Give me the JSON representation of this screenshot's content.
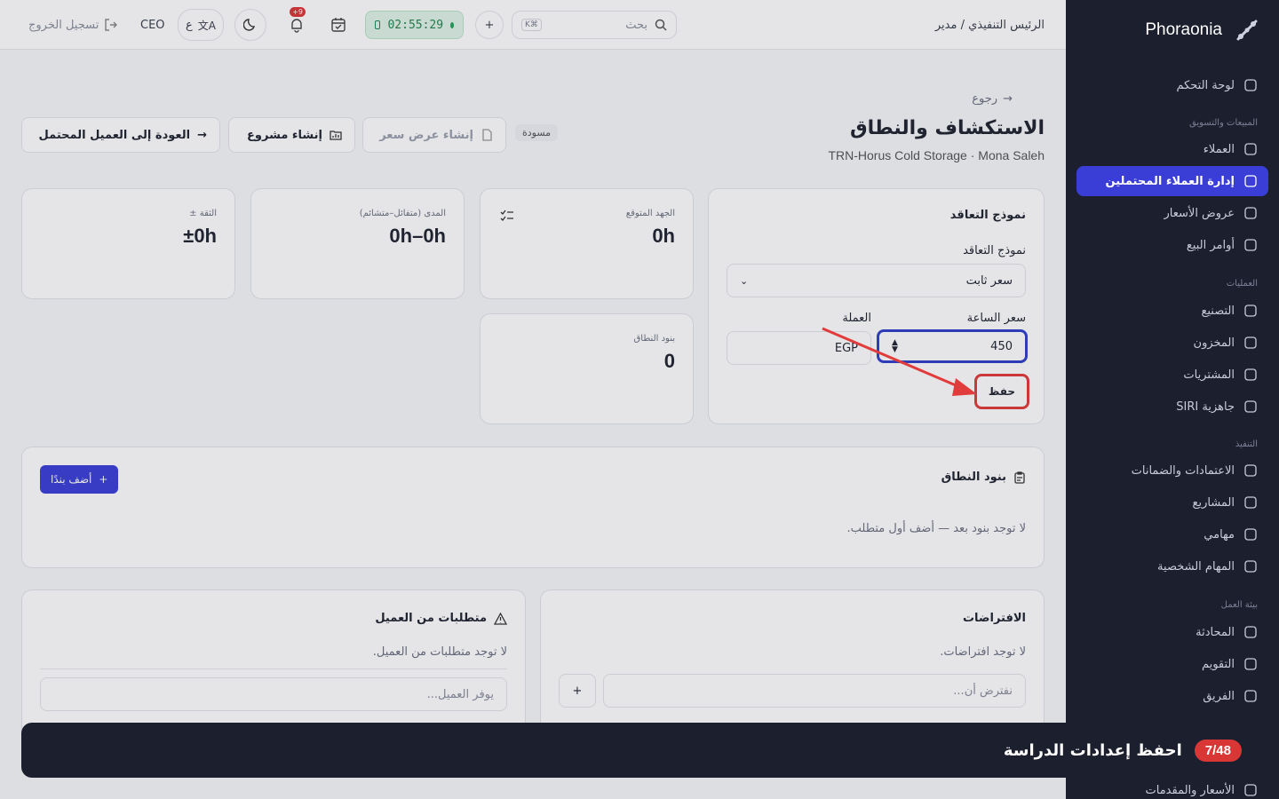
{
  "app": {
    "brand": "Phoraonia"
  },
  "topbar": {
    "breadcrumb": "الرئيس التنفيذي / مدير",
    "search_placeholder": "بحث",
    "search_shortcut": "K⌘",
    "timer": "02:55:29",
    "notifications_badge": "+9",
    "role": "CEO",
    "lang": "ع",
    "logout": "تسجيل الخروج"
  },
  "sidebar": {
    "items": [
      {
        "label": "لوحة التحكم",
        "icon": "grid-icon"
      },
      {
        "section": "المبيعات والتسويق"
      },
      {
        "label": "العملاء",
        "icon": "contact-icon"
      },
      {
        "label": "إدارة العملاء المحتملين",
        "icon": "target-icon",
        "active": true
      },
      {
        "label": "عروض الأسعار",
        "icon": "file-icon"
      },
      {
        "label": "أوامر البيع",
        "icon": "clipboard-icon"
      },
      {
        "section": "العمليات"
      },
      {
        "label": "التصنيع",
        "icon": "factory-icon"
      },
      {
        "label": "المخزون",
        "icon": "warehouse-icon"
      },
      {
        "label": "المشتريات",
        "icon": "cart-icon"
      },
      {
        "label": "جاهزية SIRI",
        "icon": "gauge-icon"
      },
      {
        "section": "التنفيذ"
      },
      {
        "label": "الاعتمادات والضمانات",
        "icon": "document-check-icon"
      },
      {
        "label": "المشاريع",
        "icon": "folder-chart-icon"
      },
      {
        "label": "مهامي",
        "icon": "list-check-icon"
      },
      {
        "label": "المهام الشخصية",
        "icon": "clipboard-list-icon"
      },
      {
        "section": "بيئة العمل"
      },
      {
        "label": "المحادثة",
        "icon": "chat-icon"
      },
      {
        "label": "التقويم",
        "icon": "calendar-icon"
      },
      {
        "label": "الفريق",
        "icon": "users-icon"
      },
      {
        "label": "الأسعار والمقدمات",
        "icon": "tag-icon"
      }
    ]
  },
  "page": {
    "back": "رجوع",
    "title": "الاستكشاف والنطاق",
    "subtitle": "TRN-Horus Cold Storage · Mona Saleh",
    "status": "مسودة",
    "btn_quote": "إنشاء عرض سعر",
    "btn_project": "إنشاء مشروع",
    "btn_back_lead": "العودة إلى العميل المحتمل"
  },
  "pricing": {
    "card_title": "نموذج التعاقد",
    "model_label": "نموذج التعاقد",
    "model_value": "سعر ثابت",
    "rate_label": "سعر الساعة",
    "rate_value": "450",
    "currency_label": "العملة",
    "currency_value": "EGP",
    "save": "حفظ"
  },
  "stats": [
    {
      "label": "الجهد المتوقع",
      "value": "0h"
    },
    {
      "label": "المدى (متفائل–متشائم)",
      "value": "0h–0h"
    },
    {
      "label": "± الثقة",
      "value": "±0h"
    },
    {
      "label": "بنود النطاق",
      "value": "0"
    }
  ],
  "scope": {
    "title": "بنود النطاق",
    "add": "أضف بندًا",
    "empty": "لا توجد بنود بعد — أضف أول متطلب."
  },
  "assumptions": {
    "title": "الافتراضات",
    "empty": "لا توجد افتراضات.",
    "placeholder": "نفترض أن..."
  },
  "client_req": {
    "title": "متطلبات من العميل",
    "empty": "لا توجد متطلبات من العميل.",
    "placeholder": "يوفر العميل..."
  },
  "tour": {
    "title": "احفظ إعدادات الدراسة",
    "step": "7/48"
  },
  "colors": {
    "accent": "#3b3ed6",
    "sidebar": "#1c1f2e",
    "highlight": "#e23b3b"
  }
}
